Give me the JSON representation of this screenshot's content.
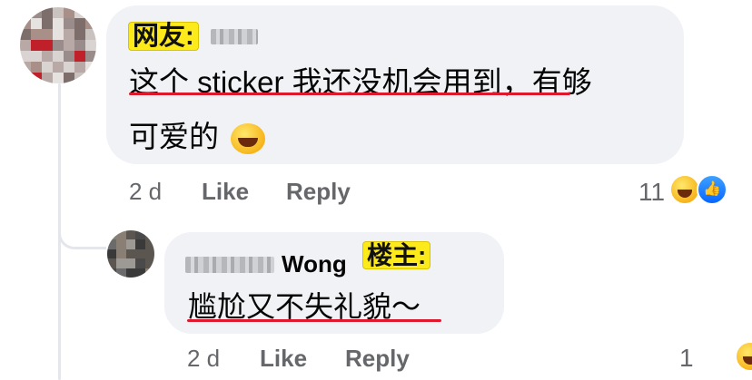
{
  "comment": {
    "badge": "网友:",
    "text_line1": "这个 sticker 我还没机会用到，有够",
    "text_line2": "可爱的",
    "emoji": "grinning-squinting-face",
    "time": "2 d",
    "like_label": "Like",
    "reply_label": "Reply",
    "reaction_count": "11",
    "reactions": [
      "haha",
      "like"
    ]
  },
  "reply": {
    "author_name": "Wong",
    "badge": "楼主:",
    "text": "尴尬又不失礼貌～",
    "time": "2 d",
    "like_label": "Like",
    "reply_label": "Reply",
    "reaction_count": "1",
    "reactions": [
      "haha"
    ]
  },
  "colors": {
    "bubble": "#f0f2f5",
    "badge_yellow": "#fdea1b",
    "underline_red": "#e0182d",
    "meta_gray": "#65676b",
    "like_blue": "#0866ff"
  }
}
